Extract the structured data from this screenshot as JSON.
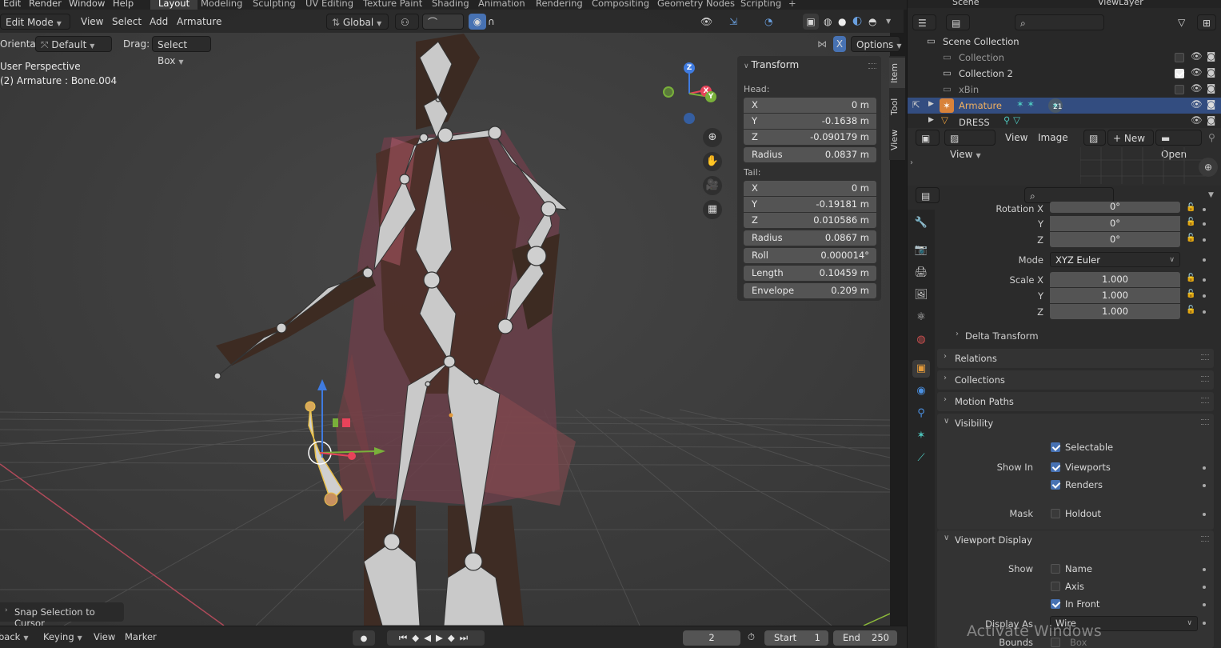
{
  "menubar": {
    "items": [
      "Edit",
      "Render",
      "Window",
      "Help"
    ],
    "workspaces": [
      "Layout",
      "Modeling",
      "Sculpting",
      "UV Editing",
      "Texture Paint",
      "Shading",
      "Animation",
      "Rendering",
      "Compositing",
      "Geometry Nodes",
      "Scripting"
    ],
    "active_workspace": "Layout",
    "add_tab": "+",
    "scene": "Scene",
    "view_layer": "ViewLayer"
  },
  "viewport_header": {
    "mode": "Edit Mode",
    "menus": [
      "View",
      "Select",
      "Add",
      "Armature"
    ],
    "transform_orientation": "Global",
    "options": "Options",
    "x_mirror": "X"
  },
  "tool_header": {
    "orientation_label": "Orientation:",
    "orientation_value": "Default",
    "drag_label": "Drag:",
    "drag_value": "Select Box"
  },
  "viewport_info": {
    "perspective": "User Perspective",
    "object": "(2) Armature : Bone.004"
  },
  "npanel": {
    "title": "Transform",
    "head_label": "Head:",
    "head": [
      {
        "label": "X",
        "value": "0 m"
      },
      {
        "label": "Y",
        "value": "-0.1638 m"
      },
      {
        "label": "Z",
        "value": "-0.090179 m"
      }
    ],
    "head_radius": {
      "label": "Radius",
      "value": "0.0837 m"
    },
    "tail_label": "Tail:",
    "tail": [
      {
        "label": "X",
        "value": "0 m"
      },
      {
        "label": "Y",
        "value": "-0.19181 m"
      },
      {
        "label": "Z",
        "value": "0.010586 m"
      }
    ],
    "extra": [
      {
        "label": "Radius",
        "value": "0.0867 m"
      },
      {
        "label": "Roll",
        "value": "0.000014°"
      },
      {
        "label": "Length",
        "value": "0.10459 m"
      },
      {
        "label": "Envelope",
        "value": "0.209 m"
      }
    ],
    "tabs": [
      "Item",
      "Tool",
      "View"
    ]
  },
  "gizmo": {
    "x": "X",
    "y": "Y",
    "z": "Z"
  },
  "snap_popup": "Snap Selection to Cursor",
  "timeline": {
    "playback": "Playback",
    "keying": "Keying",
    "view": "View",
    "marker": "Marker",
    "current_frame": "2",
    "start_label": "Start",
    "start": "1",
    "end_label": "End",
    "end": "250"
  },
  "outliner": {
    "scene_collection": "Scene Collection",
    "rows": [
      {
        "name": "Collection",
        "checked": false
      },
      {
        "name": "Collection 2",
        "checked": true
      },
      {
        "name": "xBin",
        "checked": false
      }
    ],
    "armature": "Armature",
    "armature_count": "21",
    "dress": "DRESS"
  },
  "image_editor": {
    "menus": [
      "View",
      "View",
      "Image"
    ],
    "new": "New",
    "open": "Open"
  },
  "properties": {
    "rotation": [
      {
        "label": "Rotation X",
        "value": "0°"
      },
      {
        "label": "Y",
        "value": "0°"
      },
      {
        "label": "Z",
        "value": "0°"
      }
    ],
    "mode_label": "Mode",
    "mode_value": "XYZ Euler",
    "scale": [
      {
        "label": "Scale X",
        "value": "1.000"
      },
      {
        "label": "Y",
        "value": "1.000"
      },
      {
        "label": "Z",
        "value": "1.000"
      }
    ],
    "delta_transform": "Delta Transform",
    "sections": [
      "Relations",
      "Collections",
      "Motion Paths",
      "Visibility"
    ],
    "visibility": {
      "selectable": "Selectable",
      "show_in_label": "Show In",
      "viewports": "Viewports",
      "renders": "Renders",
      "mask_label": "Mask",
      "holdout": "Holdout"
    },
    "viewport_display": "Viewport Display",
    "display": {
      "show_label": "Show",
      "name": "Name",
      "axis": "Axis",
      "in_front": "In Front",
      "display_as_label": "Display As",
      "display_as_value": "Wire",
      "bounds_label": "Bounds",
      "bounds_value": "Box"
    }
  },
  "watermark": "Activate Windows",
  "colors": {
    "accent": "#4772b3",
    "selection": "#334d80",
    "axis_x": "#e8435a",
    "axis_y": "#79b03a",
    "axis_z": "#3f7be0",
    "bone": "#c8c8c8"
  }
}
